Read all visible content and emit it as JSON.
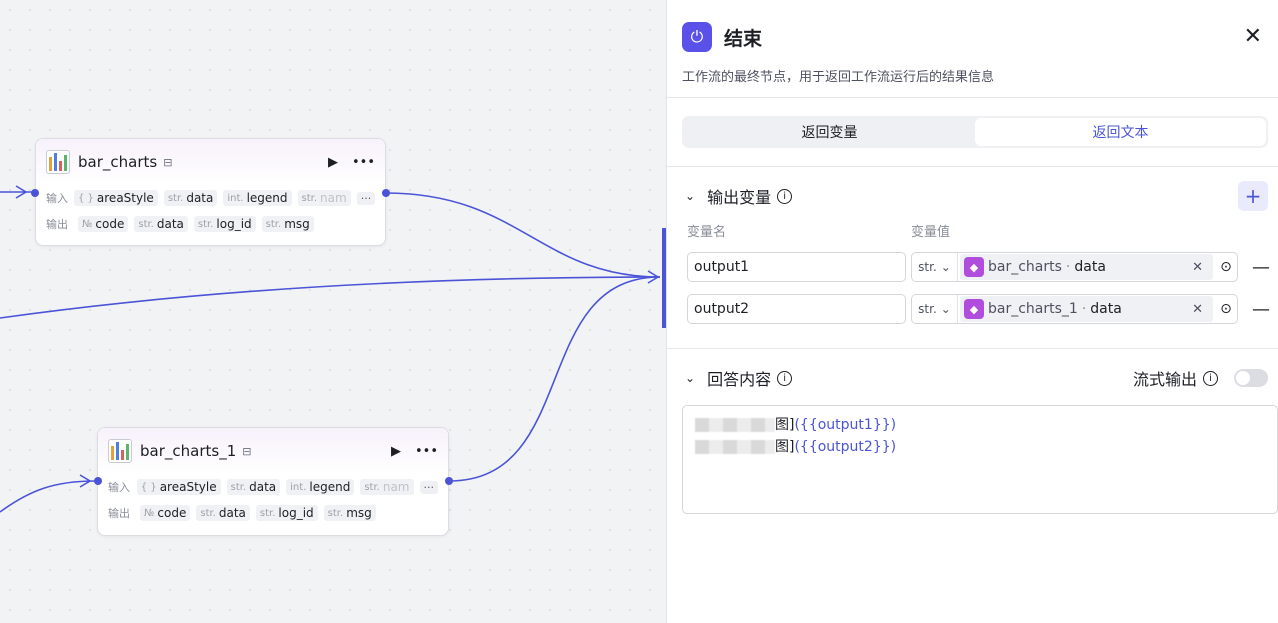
{
  "canvas": {
    "nodes": [
      {
        "title": "bar_charts",
        "input_label": "输入",
        "output_label": "输出",
        "inputs": [
          {
            "type": "{ }",
            "name": "areaStyle"
          },
          {
            "type": "str.",
            "name": "data"
          },
          {
            "type": "int.",
            "name": "legend"
          },
          {
            "type": "str.",
            "name": "nam"
          }
        ],
        "outputs": [
          {
            "type": "№",
            "name": "code"
          },
          {
            "type": "str.",
            "name": "data"
          },
          {
            "type": "str.",
            "name": "log_id"
          },
          {
            "type": "str.",
            "name": "msg"
          }
        ]
      },
      {
        "title": "bar_charts_1",
        "input_label": "输入",
        "output_label": "输出",
        "inputs": [
          {
            "type": "{ }",
            "name": "areaStyle"
          },
          {
            "type": "str.",
            "name": "data"
          },
          {
            "type": "int.",
            "name": "legend"
          },
          {
            "type": "str.",
            "name": "nam"
          }
        ],
        "outputs": [
          {
            "type": "№",
            "name": "code"
          },
          {
            "type": "str.",
            "name": "data"
          },
          {
            "type": "str.",
            "name": "log_id"
          },
          {
            "type": "str.",
            "name": "msg"
          }
        ]
      }
    ],
    "icons": {
      "run": "play-icon",
      "more": "more-icon",
      "node": "bar-chart-icon"
    }
  },
  "panel": {
    "title": "结束",
    "description": "工作流的最终节点，用于返回工作流运行后的结果信息",
    "tabs": [
      {
        "label": "返回变量",
        "active": false
      },
      {
        "label": "返回文本",
        "active": true
      }
    ],
    "output_section": {
      "title": "输出变量",
      "col_name": "变量名",
      "col_value": "变量值",
      "rows": [
        {
          "name": "output1",
          "type": "str.",
          "ref_node": "bar_charts",
          "ref_field": "data"
        },
        {
          "name": "output2",
          "type": "str.",
          "ref_node": "bar_charts_1",
          "ref_field": "data"
        }
      ]
    },
    "answer_section": {
      "title": "回答内容",
      "stream_label": "流式输出",
      "stream_on": false,
      "lines": [
        {
          "suffix": "图]",
          "var": "({{output1}})"
        },
        {
          "suffix": "图]",
          "var": "({{output2}})"
        }
      ]
    }
  },
  "colors": {
    "accent": "#4b54d6",
    "edge": "#4b54d6",
    "end_icon_bg": "#5a52e8",
    "ref_cube": "#b04ddc"
  }
}
